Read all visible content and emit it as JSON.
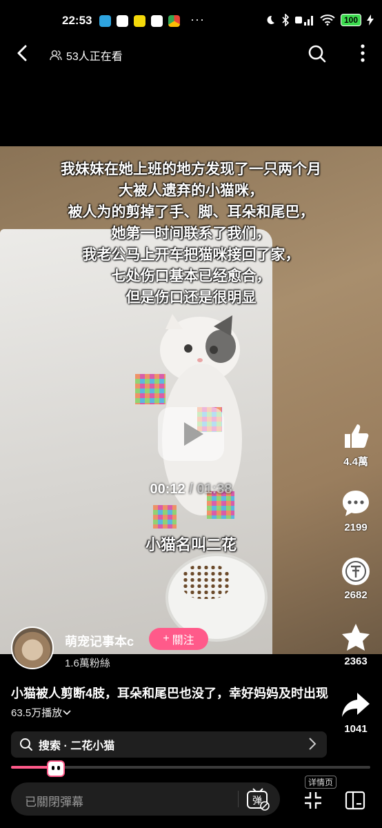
{
  "status_bar": {
    "time": "22:53",
    "dots": "···",
    "battery": "100",
    "apps": [
      {
        "name": "telegram-icon",
        "color": "#2ea4e0"
      },
      {
        "name": "google-icon",
        "color": "#ffffff"
      },
      {
        "name": "app-yellow-icon",
        "color": "#f5d90a"
      },
      {
        "name": "play-store-icon",
        "color": "#ffffff"
      },
      {
        "name": "chrome-icon",
        "color": "#e94335"
      }
    ]
  },
  "top_bar": {
    "viewers": "53人正在看"
  },
  "video": {
    "subtitle_lines": [
      "我妹妹在她上班的地方发现了一只两个月",
      "大被人遗弃的小猫咪，",
      "被人为的剪掉了手、脚、耳朵和尾巴，",
      "她第一时间联系了我们，",
      "我老公马上开车把猫咪接回了家，",
      "七处伤口基本已经愈合，",
      "但是伤口还是很明显"
    ],
    "current_time": "00:12",
    "separator": " / ",
    "duration": "01:38",
    "caption": "小猫名叫二花"
  },
  "actions": {
    "like_count": "4.4萬",
    "comment_count": "2199",
    "coin_count": "2682",
    "favorite_count": "2363",
    "share_count": "1041"
  },
  "author": {
    "name": "萌宠记事本c",
    "follow_label": "關注",
    "follow_plus": "+",
    "fans": "1.6萬粉絲"
  },
  "video_info": {
    "title": "小猫被人剪断4肢，耳朵和尾巴也没了，幸好妈妈及时出现",
    "plays": "63.5万播放"
  },
  "search": {
    "label": "搜索 · 二花小猫"
  },
  "progress": {
    "fraction": 0.122
  },
  "bottom_bar": {
    "danmaku_placeholder": "已關閉彈幕",
    "danmaku_button": "弹",
    "detail_label": "详情页"
  },
  "colors": {
    "accent": "#ff5a8a",
    "background": "#000000"
  }
}
